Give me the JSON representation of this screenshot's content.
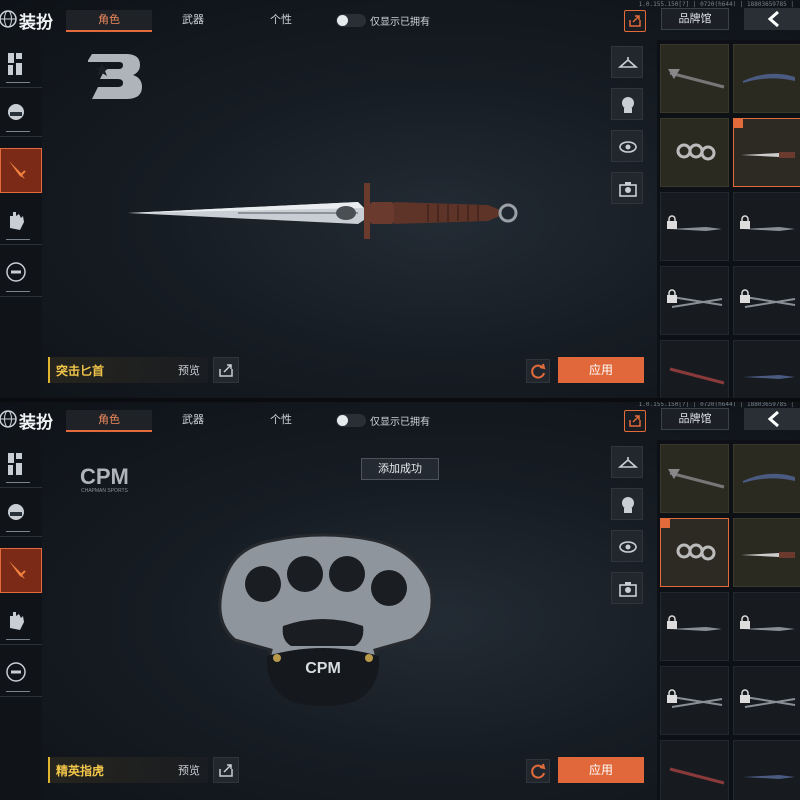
{
  "build_info": "1.0.155.150[?] | 0720(h644) | 18803659785 |",
  "colors": {
    "accent": "#e36a3a",
    "item_name": "#f1c54a",
    "apply": "#e0683a"
  },
  "screens": [
    {
      "title": "装扮",
      "tabs": [
        "角色",
        "武器",
        "个性"
      ],
      "active_tab": "角色",
      "owned_toggle_label": "仅显示已拥有",
      "brand_button": "品牌馆",
      "item_name": "突击匕首",
      "preview_label": "预览",
      "apply_label": "应用",
      "brand_logo": "b3-logo",
      "weapon_icon": "dagger-icon",
      "toast": null
    },
    {
      "title": "装扮",
      "tabs": [
        "角色",
        "武器",
        "个性"
      ],
      "active_tab": "角色",
      "owned_toggle_label": "仅显示已拥有",
      "brand_button": "品牌馆",
      "item_name": "精英指虎",
      "preview_label": "预览",
      "apply_label": "应用",
      "brand_logo": "cpm-logo",
      "brand_logo_text": "CPM",
      "brand_logo_subtext": "CHAPMAN SPORTS",
      "weapon_icon": "brass-knuckles-icon",
      "toast": "添加成功"
    }
  ]
}
